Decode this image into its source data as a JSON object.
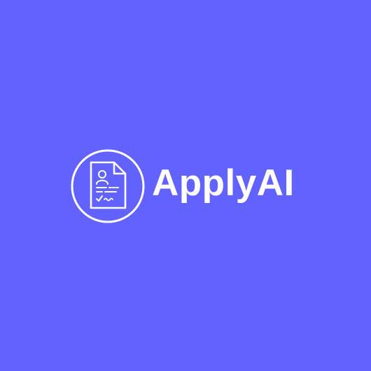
{
  "brand": {
    "name": "ApplyAI",
    "icon": "resume-document-icon"
  },
  "colors": {
    "background": "#6262fe",
    "foreground": "#ffffff"
  }
}
